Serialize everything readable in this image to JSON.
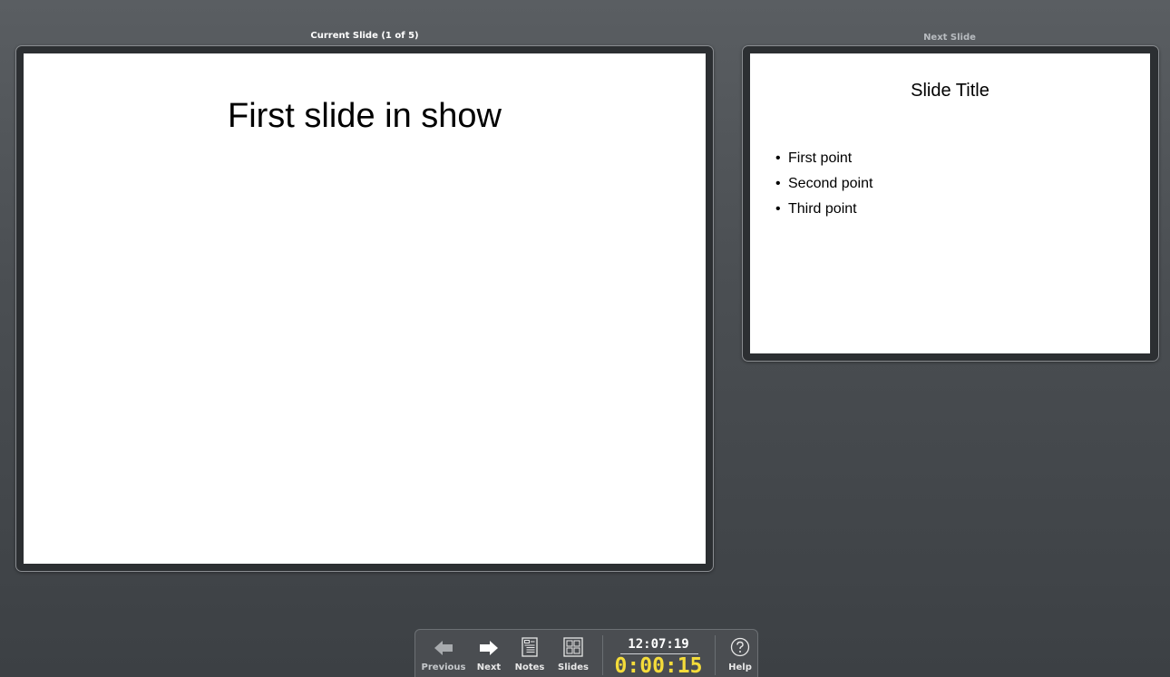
{
  "current": {
    "label": "Current Slide (1 of 5)",
    "title": "First slide in show"
  },
  "next": {
    "label": "Next Slide",
    "title": "Slide Title",
    "bullets": [
      "First point",
      "Second point",
      "Third point"
    ]
  },
  "toolbar": {
    "previous_label": "Previous",
    "next_label": "Next",
    "notes_label": "Notes",
    "slides_label": "Slides",
    "clock": "12:07:19",
    "timer": "0:00:15",
    "help_label": "Help"
  },
  "colors": {
    "timer": "#f4dc3a",
    "background": "#4b4f53"
  },
  "icons": {
    "previous": "arrow-left-icon",
    "next": "arrow-right-icon",
    "notes": "notes-icon",
    "slides": "slides-grid-icon",
    "help": "help-circle-icon"
  }
}
